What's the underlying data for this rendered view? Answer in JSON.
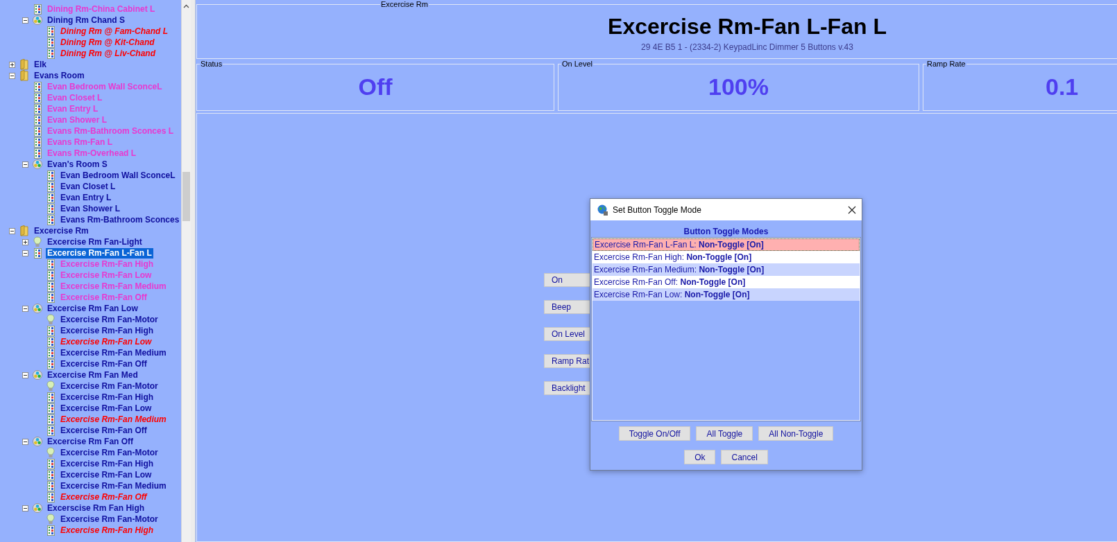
{
  "tree": [
    {
      "children": [
        {
          "label": "Dining Rm-China Cabinet L",
          "kind": "keypad",
          "color": "#e838d0",
          "italic": false,
          "selected": false
        },
        {
          "label": "Dining Rm Chand S",
          "kind": "scene",
          "color": "#10109f",
          "italic": false,
          "selected": false,
          "expanded": true,
          "children": [
            {
              "label": "Dining Rm @ Fam-Chand L",
              "kind": "keypad",
              "color": "#ff0000",
              "italic": true,
              "selected": false
            },
            {
              "label": "Dining Rm @ Kit-Chand",
              "kind": "keypad",
              "color": "#ff0000",
              "italic": true,
              "selected": false
            },
            {
              "label": "Dining Rm @ Liv-Chand",
              "kind": "keypad",
              "color": "#ff0000",
              "italic": true,
              "selected": false
            }
          ]
        }
      ]
    },
    {
      "label": "Elk",
      "kind": "folder",
      "color": "#10109f",
      "italic": false,
      "selected": false,
      "expanded": false
    },
    {
      "label": "Evans Room",
      "kind": "folder",
      "color": "#10109f",
      "italic": false,
      "selected": false,
      "expanded": true,
      "children": [
        {
          "label": "Evan Bedroom Wall SconceL",
          "kind": "keypad",
          "color": "#e838d0",
          "italic": false,
          "selected": false
        },
        {
          "label": "Evan Closet L",
          "kind": "keypad",
          "color": "#e838d0",
          "italic": false,
          "selected": false
        },
        {
          "label": "Evan Entry L",
          "kind": "keypad",
          "color": "#e838d0",
          "italic": false,
          "selected": false
        },
        {
          "label": "Evan Shower L",
          "kind": "keypad",
          "color": "#e838d0",
          "italic": false,
          "selected": false
        },
        {
          "label": "Evans Rm-Bathroom Sconces L",
          "kind": "keypad",
          "color": "#e838d0",
          "italic": false,
          "selected": false
        },
        {
          "label": "Evans Rm-Fan L",
          "kind": "keypad",
          "color": "#e838d0",
          "italic": false,
          "selected": false
        },
        {
          "label": "Evans Rm-Overhead L",
          "kind": "keypad",
          "color": "#e838d0",
          "italic": false,
          "selected": false
        },
        {
          "label": "Evan's Room S",
          "kind": "scene",
          "color": "#10109f",
          "italic": false,
          "selected": false,
          "expanded": true,
          "children": [
            {
              "label": "Evan Bedroom Wall SconceL",
              "kind": "keypad",
              "color": "#10109f",
              "italic": false,
              "selected": false
            },
            {
              "label": "Evan Closet L",
              "kind": "keypad",
              "color": "#10109f",
              "italic": false,
              "selected": false
            },
            {
              "label": "Evan Entry L",
              "kind": "keypad",
              "color": "#10109f",
              "italic": false,
              "selected": false
            },
            {
              "label": "Evan Shower L",
              "kind": "keypad",
              "color": "#10109f",
              "italic": false,
              "selected": false
            },
            {
              "label": "Evans Rm-Bathroom Sconces",
              "kind": "keypad",
              "color": "#10109f",
              "italic": false,
              "selected": false
            }
          ]
        }
      ]
    },
    {
      "label": "Excercise Rm",
      "kind": "folder",
      "color": "#10109f",
      "italic": false,
      "selected": false,
      "expanded": true,
      "children": [
        {
          "label": "Excercise Rm Fan-Light",
          "kind": "bulb",
          "color": "#10109f",
          "italic": false,
          "selected": false,
          "expanded": false
        },
        {
          "label": "Excercise Rm-Fan L-Fan L",
          "kind": "keypad",
          "italic": false,
          "selected": true,
          "expanded": true,
          "children": [
            {
              "label": "Excercise Rm-Fan High",
              "kind": "keypad",
              "color": "#e838d0",
              "italic": false,
              "selected": false
            },
            {
              "label": "Excercise Rm-Fan Low",
              "kind": "keypad",
              "color": "#e838d0",
              "italic": false,
              "selected": false
            },
            {
              "label": "Excercise Rm-Fan Medium",
              "kind": "keypad",
              "color": "#e838d0",
              "italic": false,
              "selected": false
            },
            {
              "label": "Excercise Rm-Fan Off",
              "kind": "keypad",
              "color": "#e838d0",
              "italic": false,
              "selected": false
            }
          ]
        },
        {
          "label": "Excercise Rm Fan Low",
          "kind": "scene",
          "color": "#10109f",
          "italic": false,
          "selected": false,
          "expanded": true,
          "children": [
            {
              "label": "Excercise Rm Fan-Motor",
              "kind": "bulb",
              "color": "#10109f",
              "italic": false,
              "selected": false
            },
            {
              "label": "Excercise Rm-Fan High",
              "kind": "keypad",
              "color": "#10109f",
              "italic": false,
              "selected": false
            },
            {
              "label": "Excercise Rm-Fan Low",
              "kind": "keypad",
              "color": "#ff0000",
              "italic": true,
              "selected": false
            },
            {
              "label": "Excercise Rm-Fan Medium",
              "kind": "keypad",
              "color": "#10109f",
              "italic": false,
              "selected": false
            },
            {
              "label": "Excercise Rm-Fan Off",
              "kind": "keypad",
              "color": "#10109f",
              "italic": false,
              "selected": false
            }
          ]
        },
        {
          "label": "Excercise Rm Fan Med",
          "kind": "scene",
          "color": "#10109f",
          "italic": false,
          "selected": false,
          "expanded": true,
          "children": [
            {
              "label": "Excercise Rm Fan-Motor",
              "kind": "bulb",
              "color": "#10109f",
              "italic": false,
              "selected": false
            },
            {
              "label": "Excercise Rm-Fan High",
              "kind": "keypad",
              "color": "#10109f",
              "italic": false,
              "selected": false
            },
            {
              "label": "Excercise Rm-Fan Low",
              "kind": "keypad",
              "color": "#10109f",
              "italic": false,
              "selected": false
            },
            {
              "label": "Excercise Rm-Fan Medium",
              "kind": "keypad",
              "color": "#ff0000",
              "italic": true,
              "selected": false
            },
            {
              "label": "Excercise Rm-Fan Off",
              "kind": "keypad",
              "color": "#10109f",
              "italic": false,
              "selected": false
            }
          ]
        },
        {
          "label": "Excercise Rm Fan Off",
          "kind": "scene",
          "color": "#10109f",
          "italic": false,
          "selected": false,
          "expanded": true,
          "children": [
            {
              "label": "Excercise Rm Fan-Motor",
              "kind": "bulb",
              "color": "#10109f",
              "italic": false,
              "selected": false
            },
            {
              "label": "Excercise Rm-Fan High",
              "kind": "keypad",
              "color": "#10109f",
              "italic": false,
              "selected": false
            },
            {
              "label": "Excercise Rm-Fan Low",
              "kind": "keypad",
              "color": "#10109f",
              "italic": false,
              "selected": false
            },
            {
              "label": "Excercise Rm-Fan Medium",
              "kind": "keypad",
              "color": "#10109f",
              "italic": false,
              "selected": false
            },
            {
              "label": "Excercise Rm-Fan Off",
              "kind": "keypad",
              "color": "#ff0000",
              "italic": true,
              "selected": false
            }
          ]
        },
        {
          "label": "Excerscise Rm Fan High",
          "kind": "scene",
          "color": "#10109f",
          "italic": false,
          "selected": false,
          "expanded": true,
          "children": [
            {
              "label": "Excercise Rm Fan-Motor",
              "kind": "bulb",
              "color": "#10109f",
              "italic": false,
              "selected": false
            },
            {
              "label": "Excercise Rm-Fan High",
              "kind": "keypad",
              "color": "#ff0000",
              "italic": true,
              "selected": false
            }
          ]
        }
      ]
    }
  ],
  "device": {
    "group_label": "Excercise Rm",
    "title": "Excercise Rm-Fan L-Fan L",
    "subtitle": "29 4E B5 1 - (2334-2) KeypadLinc Dimmer 5 Buttons v.43"
  },
  "status_panels": [
    {
      "label": "Status",
      "value": "Off"
    },
    {
      "label": "On Level",
      "value": "100%"
    },
    {
      "label": "Ramp Rate",
      "value": "0.1"
    }
  ],
  "actions": [
    "On",
    "Beep",
    "On Level",
    "Ramp Rat",
    "Backlight"
  ],
  "dialog": {
    "title": "Set Button Toggle Mode",
    "heading": "Button Toggle Modes",
    "rows": [
      {
        "text": "Excercise Rm-Fan L-Fan L: **Non-Toggle [On]**",
        "selected": true
      },
      {
        "text": "Excercise Rm-Fan High: **Non-Toggle [On]**",
        "selected": false
      },
      {
        "text": "Excercise Rm-Fan Medium: **Non-Toggle [On]**",
        "selected": false
      },
      {
        "text": "Excercise Rm-Fan Off: **Non-Toggle [On]**",
        "selected": false
      },
      {
        "text": "Excercise Rm-Fan Low: **Non-Toggle [On]**",
        "selected": false
      }
    ],
    "buttons": [
      "Toggle On/Off",
      "All Toggle",
      "All Non-Toggle"
    ],
    "footer_buttons": [
      "Ok",
      "Cancel"
    ]
  }
}
